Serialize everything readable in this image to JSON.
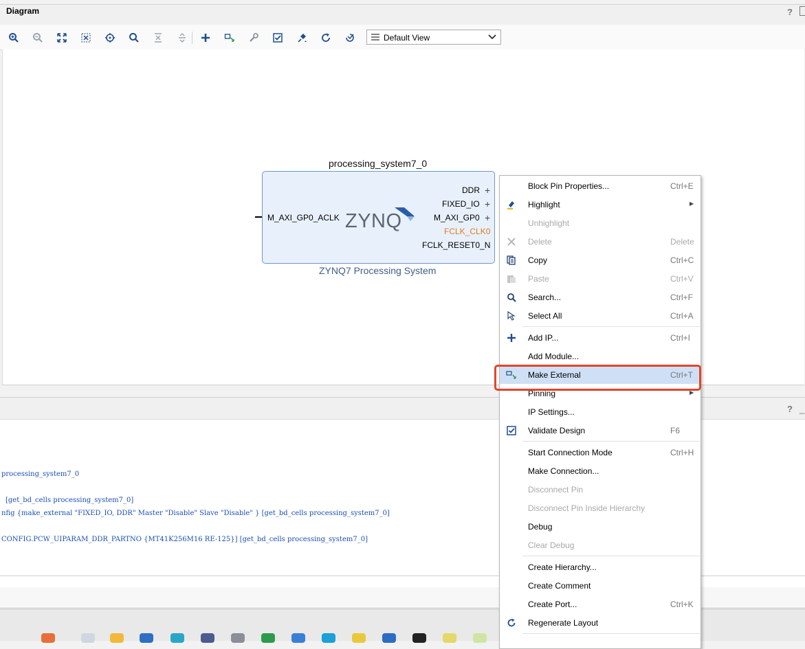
{
  "diagram": {
    "title": "Diagram",
    "help": "?",
    "view_select": "Default View",
    "toolbar": [
      "zoom-in-icon",
      "zoom-out-icon",
      "zoom-fit-icon",
      "fit-selection-icon",
      "center-icon",
      "search-icon",
      "collapse-icon",
      "expand-icon",
      "add-ip-icon",
      "make-external-icon",
      "properties-icon",
      "validate-icon",
      "pin-icon",
      "regenerate-icon",
      "optional-icon"
    ]
  },
  "block": {
    "name": "processing_system7_0",
    "subtitle": "ZYNQ7 Processing System",
    "logo": "ZYNQ",
    "input_pin": "M_AXI_GP0_ACLK",
    "output_pins": [
      "DDR",
      "FIXED_IO",
      "M_AXI_GP0",
      "FCLK_CLK0",
      "FCLK_RESET0_N"
    ],
    "colors": {
      "highlight_pin": "#e07b22",
      "block_fill": "#e8f1fb",
      "block_border": "#6f97c8"
    }
  },
  "tcl": {
    "help": "?",
    "minimize": "_",
    "lines": [
      "processing_system7_0",
      "[get_bd_cells processing_system7_0]",
      "nfig {make_external \"FIXED_IO, DDR\" Master \"Disable\" Slave \"Disable\" }  [get_bd_cells processing_system7_0]",
      "CONFIG.PCW_UIPARAM_DDR_PARTNO {MT41K256M16 RE-125}] [get_bd_cells processing_system7_0]"
    ]
  },
  "menu": {
    "items": [
      {
        "label": "Block Pin Properties...",
        "shortcut": "Ctrl+E"
      },
      {
        "label": "Highlight",
        "shortcut": ""
      },
      {
        "label": "Unhighlight",
        "shortcut": ""
      },
      {
        "label": "Delete",
        "shortcut": "Delete"
      },
      {
        "label": "Copy",
        "shortcut": "Ctrl+C"
      },
      {
        "label": "Paste",
        "shortcut": "Ctrl+V"
      },
      {
        "label": "Search...",
        "shortcut": "Ctrl+F"
      },
      {
        "label": "Select All",
        "shortcut": "Ctrl+A"
      },
      {
        "label": "Add IP...",
        "shortcut": "Ctrl+I"
      },
      {
        "label": "Add Module...",
        "shortcut": ""
      },
      {
        "label": "Make External",
        "shortcut": "Ctrl+T"
      },
      {
        "label": "Pinning",
        "shortcut": ""
      },
      {
        "label": "IP Settings...",
        "shortcut": ""
      },
      {
        "label": "Validate Design",
        "shortcut": "F6"
      },
      {
        "label": "Start Connection Mode",
        "shortcut": "Ctrl+H"
      },
      {
        "label": "Make Connection...",
        "shortcut": ""
      },
      {
        "label": "Disconnect Pin",
        "shortcut": ""
      },
      {
        "label": "Disconnect Pin Inside Hierarchy",
        "shortcut": ""
      },
      {
        "label": "Debug",
        "shortcut": ""
      },
      {
        "label": "Clear Debug",
        "shortcut": ""
      },
      {
        "label": "Create Hierarchy...",
        "shortcut": ""
      },
      {
        "label": "Create Comment",
        "shortcut": ""
      },
      {
        "label": "Create Port...",
        "shortcut": "Ctrl+K"
      },
      {
        "label": "Regenerate Layout",
        "shortcut": ""
      }
    ],
    "highlighted": "Make External",
    "highlight_color": "#e2452b"
  }
}
